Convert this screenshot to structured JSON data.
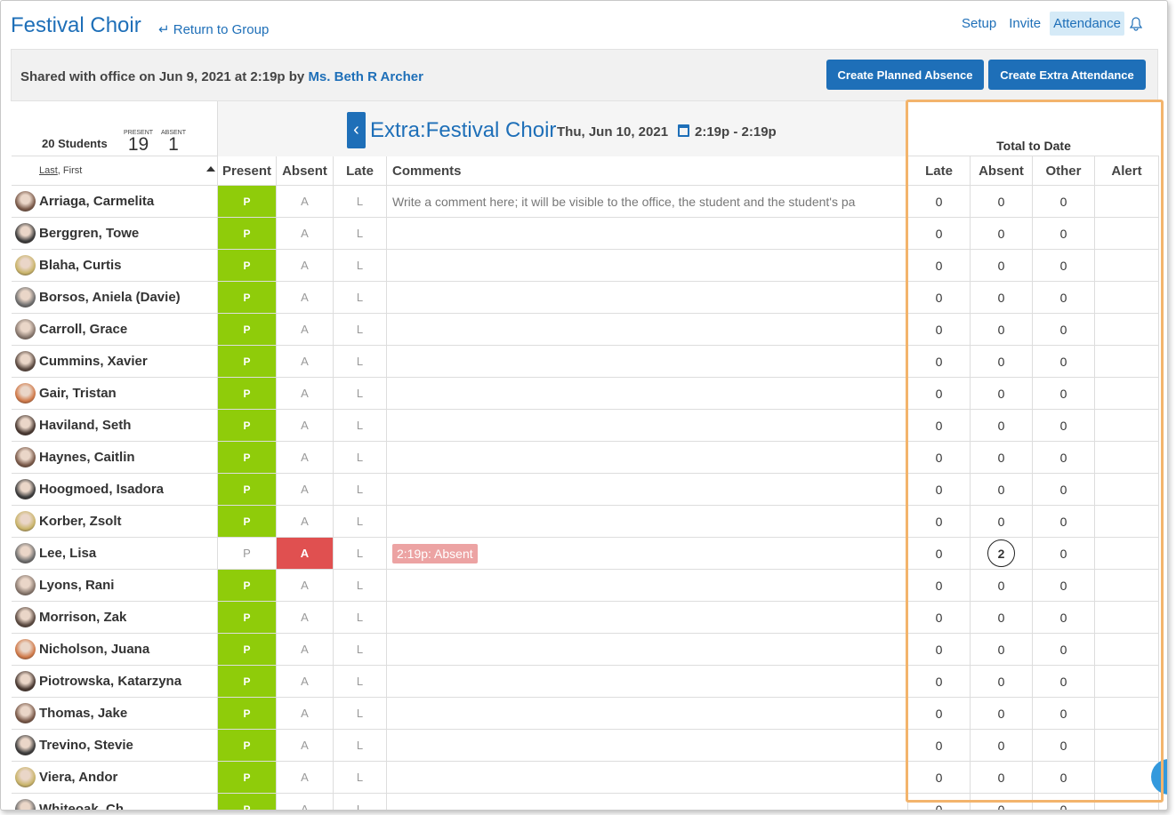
{
  "header": {
    "title": "Festival Choir",
    "return_label": "↵ Return to Group",
    "nav": [
      "Setup",
      "Invite",
      "Attendance"
    ]
  },
  "share": {
    "text": "Shared with office on Jun 9, 2021 at 2:19p by ",
    "name": "Ms. Beth R Archer",
    "btn_absence": "Create Planned Absence",
    "btn_extra": "Create Extra Attendance"
  },
  "summary": {
    "students": "20 Students",
    "present_label": "PRESENT",
    "present_count": "19",
    "absent_label": "ABSENT",
    "absent_count": "1"
  },
  "event": {
    "prev_icon": "‹",
    "title": "Extra:Festival Choir",
    "date": "Thu, Jun 10, 2021",
    "time": "2:19p - 2:19p"
  },
  "totals_label": "Total to Date",
  "columns": {
    "name_last": "Last",
    "name_first": ", First",
    "present": "Present",
    "absent": "Absent",
    "late": "Late",
    "comments": "Comments",
    "t_late": "Late",
    "t_absent": "Absent",
    "t_other": "Other",
    "t_alert": "Alert"
  },
  "comment_placeholder": "Write a comment here; it will be visible to the office, the student and the student's pa",
  "marks": {
    "p": "P",
    "a": "A",
    "l": "L"
  },
  "students": [
    {
      "name": "Arriaga, Carmelita",
      "status": "P",
      "comment": "",
      "late": "0",
      "absent": "0",
      "other": "0"
    },
    {
      "name": "Berggren, Towe",
      "status": "P",
      "comment": "",
      "late": "0",
      "absent": "0",
      "other": "0"
    },
    {
      "name": "Blaha, Curtis",
      "status": "P",
      "comment": "",
      "late": "0",
      "absent": "0",
      "other": "0"
    },
    {
      "name": "Borsos, Aniela (Davie)",
      "status": "P",
      "comment": "",
      "late": "0",
      "absent": "0",
      "other": "0"
    },
    {
      "name": "Carroll, Grace",
      "status": "P",
      "comment": "",
      "late": "0",
      "absent": "0",
      "other": "0"
    },
    {
      "name": "Cummins, Xavier",
      "status": "P",
      "comment": "",
      "late": "0",
      "absent": "0",
      "other": "0"
    },
    {
      "name": "Gair, Tristan",
      "status": "P",
      "comment": "",
      "late": "0",
      "absent": "0",
      "other": "0"
    },
    {
      "name": "Haviland, Seth",
      "status": "P",
      "comment": "",
      "late": "0",
      "absent": "0",
      "other": "0"
    },
    {
      "name": "Haynes, Caitlin",
      "status": "P",
      "comment": "",
      "late": "0",
      "absent": "0",
      "other": "0"
    },
    {
      "name": "Hoogmoed, Isadora",
      "status": "P",
      "comment": "",
      "late": "0",
      "absent": "0",
      "other": "0"
    },
    {
      "name": "Korber, Zsolt",
      "status": "P",
      "comment": "",
      "late": "0",
      "absent": "0",
      "other": "0"
    },
    {
      "name": "Lee, Lisa",
      "status": "A",
      "comment": "2:19p: Absent",
      "late": "0",
      "absent": "2",
      "other": "0",
      "highlight_absent": true
    },
    {
      "name": "Lyons, Rani",
      "status": "P",
      "comment": "",
      "late": "0",
      "absent": "0",
      "other": "0"
    },
    {
      "name": "Morrison, Zak",
      "status": "P",
      "comment": "",
      "late": "0",
      "absent": "0",
      "other": "0"
    },
    {
      "name": "Nicholson, Juana",
      "status": "P",
      "comment": "",
      "late": "0",
      "absent": "0",
      "other": "0"
    },
    {
      "name": "Piotrowska, Katarzyna",
      "status": "P",
      "comment": "",
      "late": "0",
      "absent": "0",
      "other": "0"
    },
    {
      "name": "Thomas, Jake",
      "status": "P",
      "comment": "",
      "late": "0",
      "absent": "0",
      "other": "0"
    },
    {
      "name": "Trevino, Stevie",
      "status": "P",
      "comment": "",
      "late": "0",
      "absent": "0",
      "other": "0"
    },
    {
      "name": "Viera, Andor",
      "status": "P",
      "comment": "",
      "late": "0",
      "absent": "0",
      "other": "0"
    },
    {
      "name": "Whiteoak, Ch",
      "status": "P",
      "comment": "",
      "late": "0",
      "absent": "0",
      "other": "0"
    }
  ]
}
